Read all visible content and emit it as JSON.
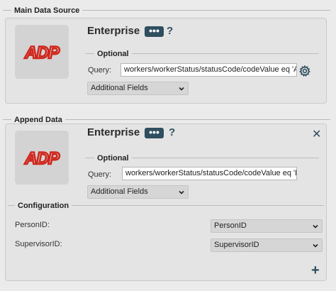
{
  "main_section": {
    "title": "Main Data Source",
    "source_name": "Enterprise",
    "dots_label": "•••",
    "help": "?",
    "optional_title": "Optional",
    "query_label": "Query:",
    "query_value": "workers/workerStatus/statusCode/codeValue eq 'A'",
    "additional_fields": "Additional Fields"
  },
  "append_section": {
    "title": "Append Data",
    "source_name": "Enterprise",
    "dots_label": "•••",
    "help": "?",
    "close": "✕",
    "optional_title": "Optional",
    "query_label": "Query:",
    "query_value": "workers/workerStatus/statusCode/codeValue eq 'L'",
    "additional_fields": "Additional Fields",
    "configuration_title": "Configuration",
    "fields": [
      {
        "label": "PersonID:",
        "value": "PersonID"
      },
      {
        "label": "SupervisorID:",
        "value": "SupervisorID"
      }
    ],
    "add": "+"
  },
  "logo": {
    "text": "ADP",
    "color": "#d0271d"
  },
  "colors": {
    "accent": "#2f4e5f",
    "background": "#ebebeb",
    "panel": "#e4e4e4"
  },
  "icons": [
    "adp-logo",
    "gear-icon",
    "chevron-down-icon",
    "close-icon",
    "plus-icon",
    "help-icon"
  ]
}
